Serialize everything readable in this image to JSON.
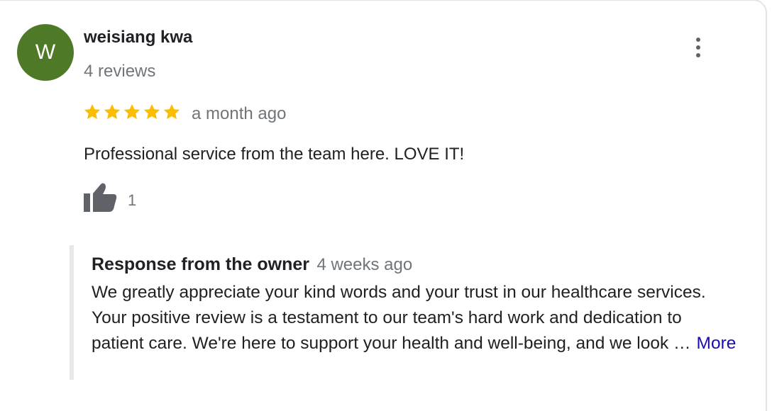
{
  "reviewer": {
    "initial": "W",
    "name": "weisiang kwa",
    "review_count": "4 reviews",
    "avatar_color": "#4e7a27"
  },
  "review": {
    "rating": 5,
    "max_rating": 5,
    "star_color": "#fbbc04",
    "date": "a month ago",
    "text": "Professional service from the team here. LOVE IT!",
    "like_count": "1",
    "like_icon": "thumbs-up-icon"
  },
  "menu": {
    "icon": "more-vert-icon"
  },
  "owner_response": {
    "title": "Response from the owner",
    "date": "4 weeks ago",
    "text": "We greatly appreciate your kind words and your trust in our healthcare services. Your positive review is a testament to our team's hard work and dedication to patient care. We're here to support your health and well-being, and we look …",
    "more_label": "More",
    "link_color": "#1a0dab"
  }
}
